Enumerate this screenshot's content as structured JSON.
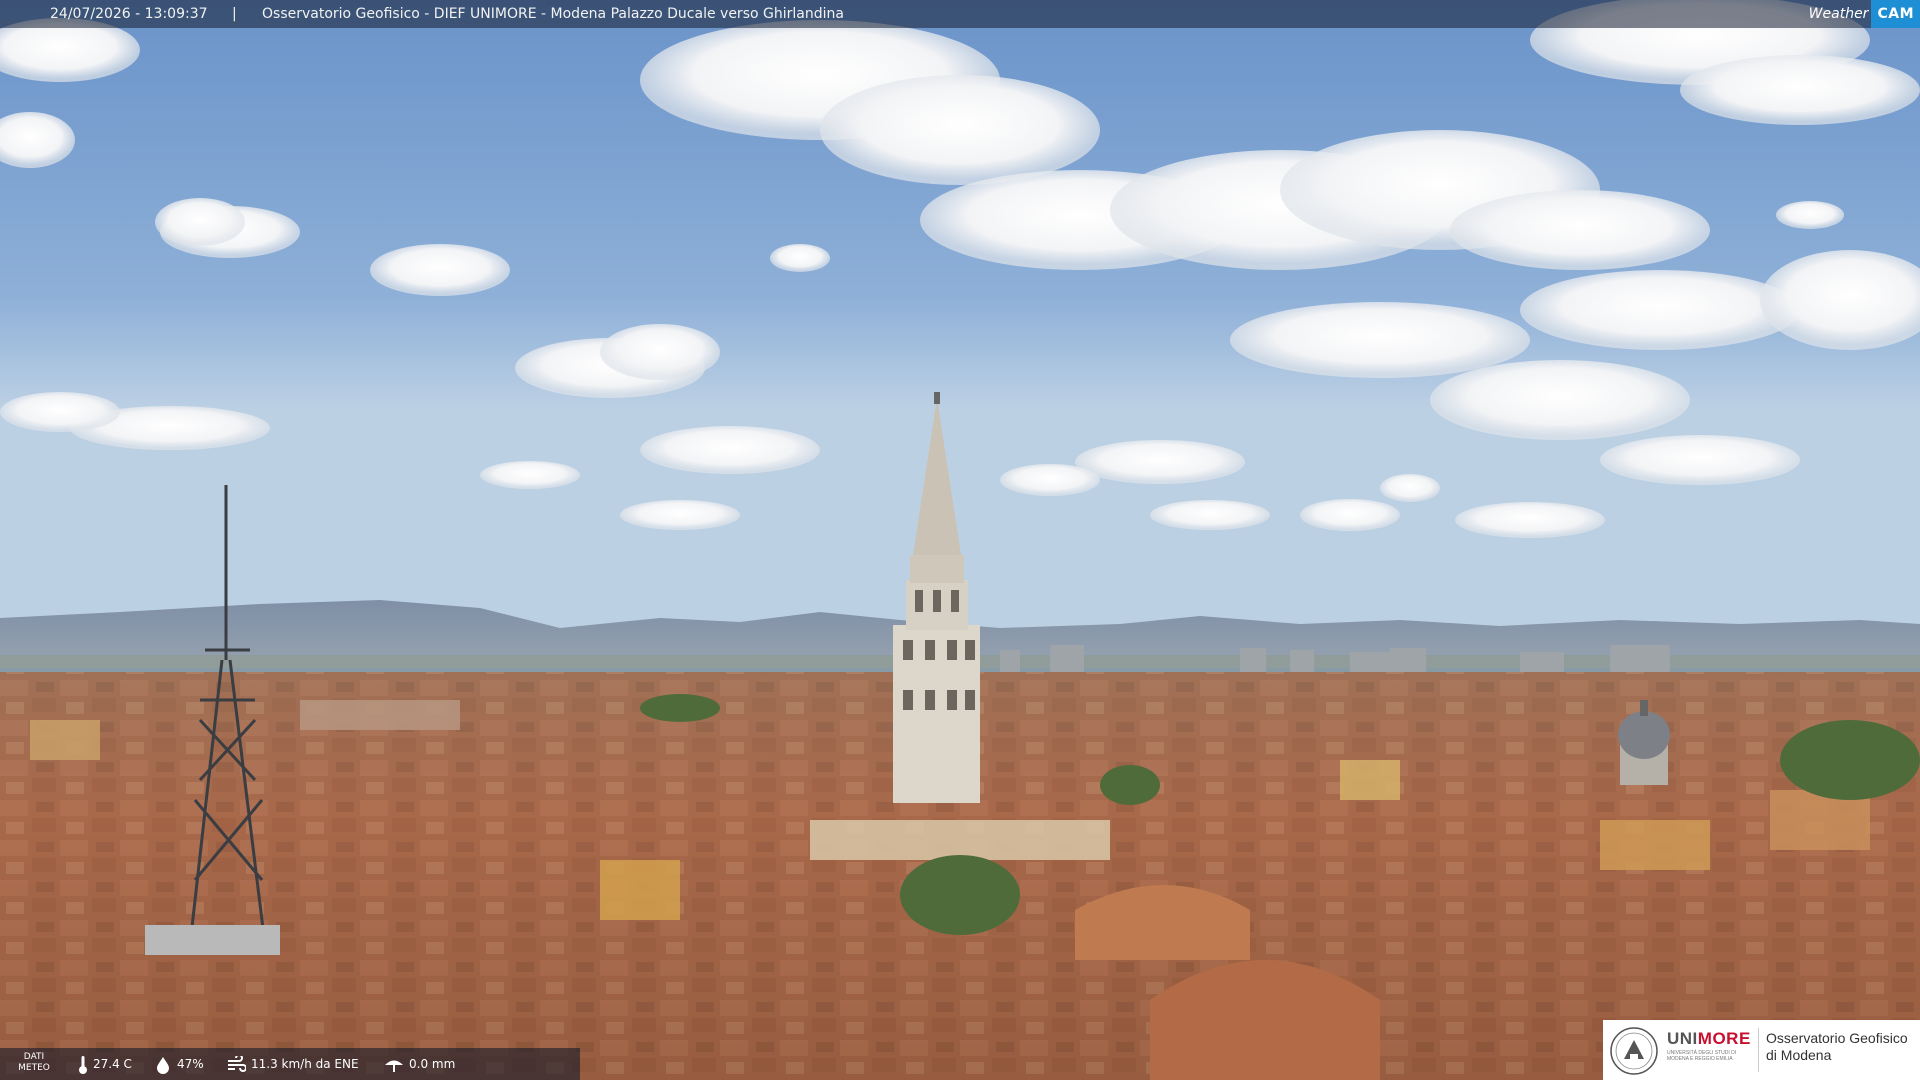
{
  "overlay": {
    "timestamp": "24/07/2026 - 13:09:37",
    "separator": "|",
    "title": "Osservatorio Geofisico - DIEF UNIMORE - Modena Palazzo Ducale verso Ghirlandina",
    "brand_weather": "Weather",
    "brand_cam": "CAM"
  },
  "meteo": {
    "label": "DATI METEO",
    "temperature": "27.4 C",
    "humidity": "47%",
    "wind": "11.3 km/h da ENE",
    "rain": "0.0 mm",
    "icons": [
      "thermometer-icon",
      "humidity-drop-icon",
      "wind-icon",
      "rain-icon"
    ]
  },
  "logo": {
    "brand_uni": "UNI",
    "brand_more": "MORE",
    "subtitle": "UNIVERSITÀ DEGLI STUDI DI MODENA E REGGIO EMILIA",
    "observatory": "Osservatorio Geofisico di Modena"
  },
  "colors": {
    "sky_top": "#6f97cc",
    "sky_horizon": "#bcd0e4",
    "roof": "#a8684a",
    "tower": "#d9d2c6",
    "brand_red": "#c8102e",
    "brand_blue": "#1e8fd4"
  }
}
